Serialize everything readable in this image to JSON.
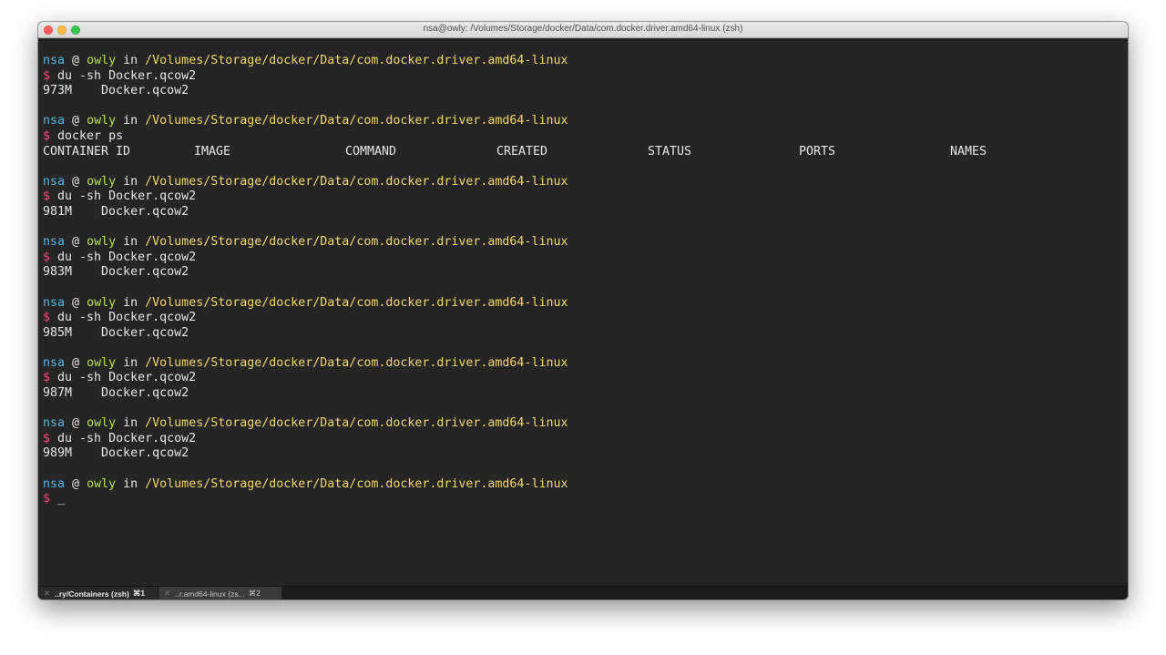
{
  "window": {
    "title": "nsa@owly: /Volumes/Storage/docker/Data/com.docker.driver.amd64-linux (zsh)"
  },
  "colors": {
    "background": "#252525",
    "user": "#53b7e8",
    "host": "#b5e04a",
    "path": "#f4d56b",
    "dollar": "#fa4d7a",
    "text": "#e6e6e6"
  },
  "prompt": {
    "user": "nsa",
    "at": "@",
    "host": "owly",
    "in": "in",
    "path": "/Volumes/Storage/docker/Data/com.docker.driver.amd64-linux",
    "symbol": "$"
  },
  "blocks": [
    {
      "command": "du -sh Docker.qcow2",
      "output": "973M    Docker.qcow2"
    },
    {
      "command": "docker ps",
      "ps_headers": [
        "CONTAINER ID",
        "IMAGE",
        "COMMAND",
        "CREATED",
        "STATUS",
        "PORTS",
        "NAMES"
      ]
    },
    {
      "command": "du -sh Docker.qcow2",
      "output": "981M    Docker.qcow2"
    },
    {
      "command": "du -sh Docker.qcow2",
      "output": "983M    Docker.qcow2"
    },
    {
      "command": "du -sh Docker.qcow2",
      "output": "985M    Docker.qcow2"
    },
    {
      "command": "du -sh Docker.qcow2",
      "output": "987M    Docker.qcow2"
    },
    {
      "command": "du -sh Docker.qcow2",
      "output": "989M    Docker.qcow2"
    }
  ],
  "current_input": "_",
  "tabs": [
    {
      "label": "..ry/Containers (zsh)",
      "shortcut": "⌘1",
      "active": true
    },
    {
      "label": "..r.amd64-linux (zs...",
      "shortcut": "⌘2",
      "active": false
    }
  ]
}
